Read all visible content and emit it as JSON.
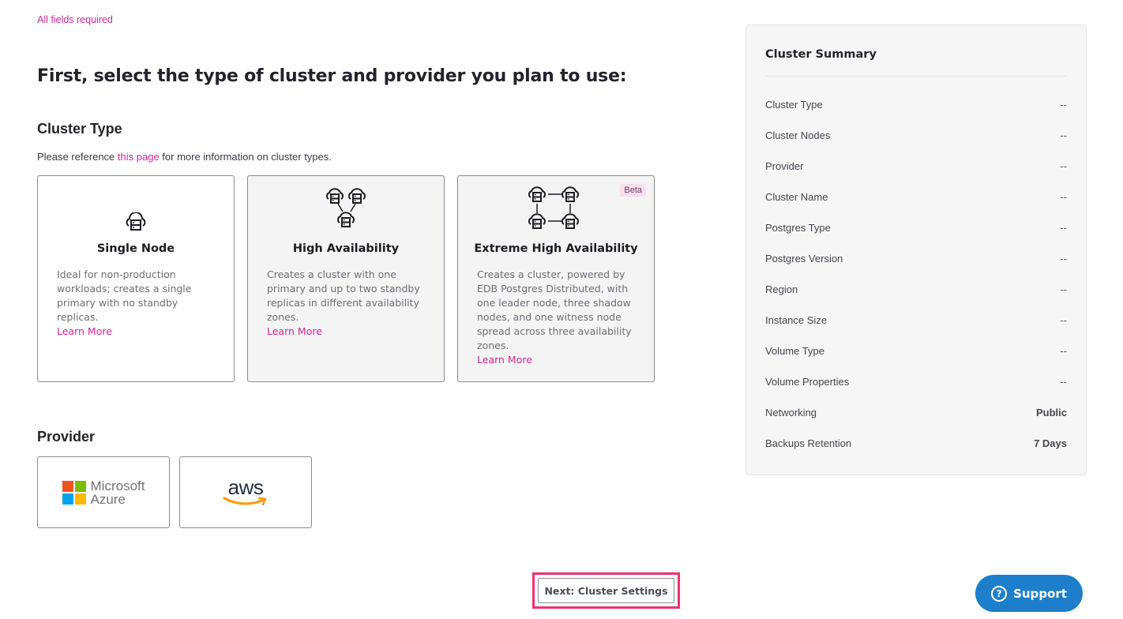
{
  "header": {
    "required_note": "All fields required",
    "title": "First, select the type of cluster and provider you plan to use:"
  },
  "cluster_type": {
    "heading": "Cluster Type",
    "reference_prefix": "Please reference ",
    "reference_link": "this page",
    "reference_suffix": " for more information on cluster types.",
    "cards": [
      {
        "icon": "single-node-cloud-icon",
        "title": "Single Node",
        "description": "Ideal for non-production workloads; creates a single primary with no standby replicas.",
        "link": "Learn More"
      },
      {
        "icon": "high-availability-cloud-icon",
        "title": "High Availability",
        "description": "Creates a cluster with one primary and up to two standby replicas in different availability zones.",
        "link": "Learn More"
      },
      {
        "icon": "extreme-high-availability-cloud-icon",
        "title": "Extreme High Availability",
        "badge": "Beta",
        "description": "Creates a cluster, powered by EDB Postgres Distributed, with one leader node, three shadow nodes, and one witness node spread across three availability zones.",
        "link": "Learn More"
      }
    ]
  },
  "provider": {
    "heading": "Provider",
    "options": [
      {
        "name": "Microsoft Azure",
        "logo_line1": "Microsoft",
        "logo_line2": "Azure",
        "colors": [
          "#f25022",
          "#7fba00",
          "#00a4ef",
          "#ffb900"
        ]
      },
      {
        "name": "AWS",
        "logo_text": "aws",
        "smile_color": "#ff9900"
      }
    ]
  },
  "summary": {
    "title": "Cluster Summary",
    "rows": [
      {
        "label": "Cluster Type",
        "value": "--"
      },
      {
        "label": "Cluster Nodes",
        "value": "--"
      },
      {
        "label": "Provider",
        "value": "--"
      },
      {
        "label": "Cluster Name",
        "value": "--"
      },
      {
        "label": "Postgres Type",
        "value": "--"
      },
      {
        "label": "Postgres Version",
        "value": "--"
      },
      {
        "label": "Region",
        "value": "--"
      },
      {
        "label": "Instance Size",
        "value": "--"
      },
      {
        "label": "Volume Type",
        "value": "--"
      },
      {
        "label": "Volume Properties",
        "value": "--"
      },
      {
        "label": "Networking",
        "value": "Public"
      },
      {
        "label": "Backups Retention",
        "value": "7 Days"
      }
    ]
  },
  "footer": {
    "next_label": "Next: Cluster Settings",
    "support_label": "Support"
  },
  "colors": {
    "accent": "#d6259a",
    "highlight": "#f0306e",
    "support": "#1d7fcb",
    "beta_bg": "#fcdcef"
  }
}
